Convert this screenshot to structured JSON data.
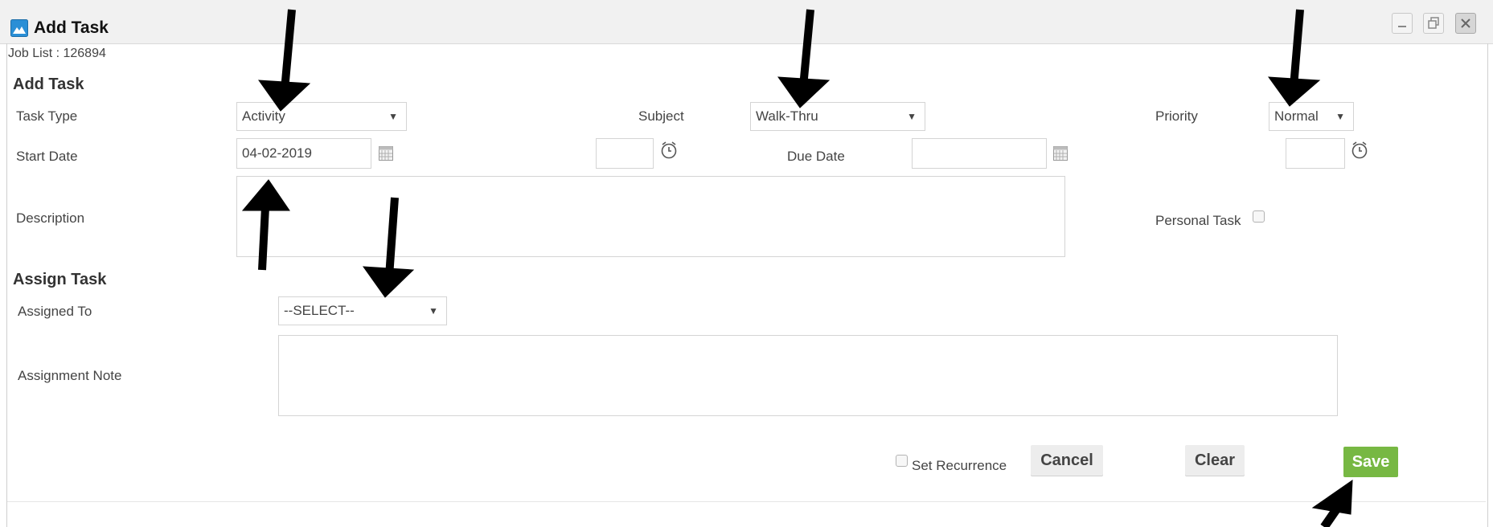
{
  "window": {
    "title": "Add Task",
    "icon": "app-icon",
    "controls": [
      "minimize-icon",
      "restore-icon",
      "close-icon"
    ]
  },
  "job_list": "Job List : 126894",
  "add_task": {
    "heading": "Add Task",
    "task_type": {
      "label": "Task Type",
      "value": "Activity"
    },
    "subject": {
      "label": "Subject",
      "value": "Walk-Thru"
    },
    "priority": {
      "label": "Priority",
      "value": "Normal"
    },
    "start_date": {
      "label": "Start Date",
      "value": "04-02-2019",
      "time_value": ""
    },
    "due_date": {
      "label": "Due Date",
      "value": "",
      "time_value": ""
    },
    "description": {
      "label": "Description",
      "value": ""
    },
    "personal_task": {
      "label": "Personal Task",
      "checked": false
    }
  },
  "assign_task": {
    "heading": "Assign Task",
    "assigned_to": {
      "label": "Assigned To",
      "value": "--SELECT--"
    },
    "assignment_note": {
      "label": "Assignment Note",
      "value": ""
    }
  },
  "footer": {
    "set_recurrence": {
      "label": "Set Recurrence",
      "checked": false
    },
    "cancel_label": "Cancel",
    "clear_label": "Clear",
    "save_label": "Save"
  },
  "colors": {
    "save": "#77b843",
    "titlebar": "#f1f1f1",
    "arrow": "#000000"
  }
}
